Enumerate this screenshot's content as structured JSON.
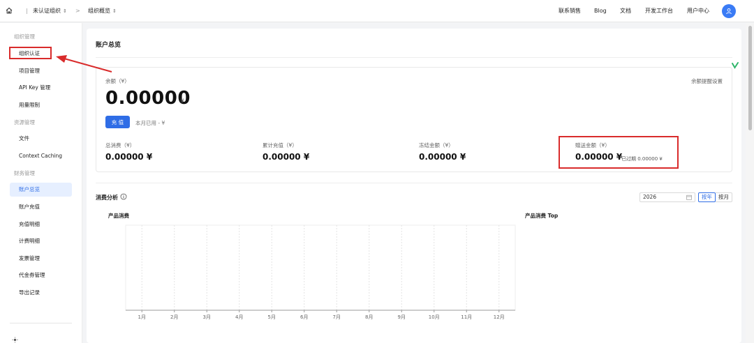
{
  "topbar": {
    "breadcrumb_org": "未认证组织",
    "breadcrumb_sep": ">",
    "breadcrumb_page": "组织概览",
    "nav": [
      "联系销售",
      "Blog",
      "文档",
      "开发工作台",
      "用户中心"
    ],
    "icons": {
      "home": "home-icon",
      "avatar": "user-icon",
      "chevron": "chevron-updown-icon"
    }
  },
  "sidebar": {
    "groups": [
      {
        "title": "组织管理",
        "items": [
          "组织认证",
          "项目管理",
          "API Key 管理",
          "用量限制"
        ]
      },
      {
        "title": "资源管理",
        "items": [
          "文件",
          "Context Caching"
        ]
      },
      {
        "title": "财务管理",
        "items": [
          "账户总览",
          "账户充值",
          "充值明细",
          "计费明细",
          "发票管理",
          "代金券管理",
          "导出记录"
        ]
      }
    ],
    "active_item": "账户总览",
    "bottom_icon": "sun-icon"
  },
  "main": {
    "title": "账户总览",
    "balance": {
      "label": "余额（¥）",
      "value": "0.00000",
      "unit": "¥",
      "alert_setting": "余额提醒设置",
      "recharge_label": "充 值",
      "month_used": "本月已用 - ¥"
    },
    "stats": [
      {
        "label": "总消费（¥）",
        "value": "0.00000 ¥"
      },
      {
        "label": "累计充值（¥）",
        "value": "0.00000 ¥"
      },
      {
        "label": "冻结金额（¥）",
        "value": "0.00000 ¥"
      },
      {
        "label": "赠送金额（¥）",
        "value": "0.00000 ¥",
        "expired": "已过期 0.00000 ¥"
      }
    ],
    "analysis": {
      "title": "消费分析",
      "info_icon": "info-icon",
      "year": "2026",
      "calendar_icon": "calendar-icon",
      "toggle": [
        "按年",
        "按月"
      ],
      "active_toggle": "按年"
    },
    "charts": {
      "left_title": "产品消费",
      "right_title": "产品消费 Top"
    }
  },
  "chart_data": {
    "type": "bar",
    "title": "产品消费",
    "categories": [
      "1月",
      "2月",
      "3月",
      "4月",
      "5月",
      "6月",
      "7月",
      "8月",
      "9月",
      "10月",
      "11月",
      "12月"
    ],
    "series": [],
    "xlabel": "",
    "ylabel": "",
    "grid": true,
    "legend": "none"
  },
  "colors": {
    "primary": "#2f6de6",
    "annotation": "#d92b2b",
    "active_bg": "#e6efff"
  }
}
